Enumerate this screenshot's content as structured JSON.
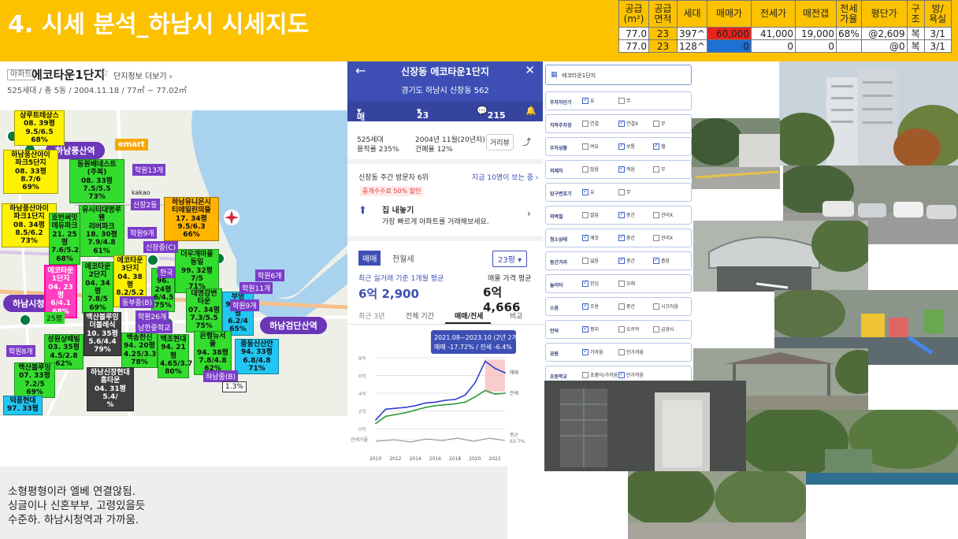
{
  "header": {
    "title": "4. 시세 분석_하남시 시세지도",
    "table": {
      "columns": [
        "공급\n(m²)",
        "공급\n면적",
        "세대",
        "매매가",
        "전세가",
        "매전갭",
        "전세\n가율",
        "평단가",
        "구\n조",
        "방/\n욕실"
      ],
      "rows": [
        [
          "77.0",
          "23",
          "397^",
          "60,000",
          "41,000",
          "19,000",
          "68%",
          "@2,609",
          "복",
          "3/1"
        ],
        [
          "77.0",
          "23",
          "128^",
          "0",
          "0",
          "0",
          "",
          "@0",
          "복",
          "3/1"
        ]
      ]
    }
  },
  "apt": {
    "tag": "아파트",
    "name": "에코타운1단지",
    "star": "☆",
    "more": "단지정보 더보기",
    "meta": "525세대 / 총 5동 / 2004.11.18 / 77㎡ ~ 77.02㎡"
  },
  "map": {
    "stations": [
      "하남풍산역",
      "하남시청역",
      "하남검단산역"
    ],
    "emart": "emart",
    "kakao": "kakao",
    "labels": [
      {
        "t": "상루트테상스\n08. 39평\n9.5/6.5\n68%",
        "c": "y"
      },
      {
        "t": "하남풍산아이\n파크5단지\n08. 33평\n8.7/6\n69%",
        "c": "y"
      },
      {
        "t": "동원베네스트\n(주복)\n08. 33평\n7.5/5.5\n73%",
        "c": "g"
      },
      {
        "t": "하남풍산아이\n파크1단지\n08. 34평\n8.5/6.2\n73%",
        "c": "y"
      },
      {
        "t": "유시티대명루웬\n리버파크\n18. 30평\n7.9/4.8\n61%",
        "c": "g"
      },
      {
        "t": "하남유니온시\n티에일린의뜰\n17. 34평\n9.5/6.3\n66%",
        "c": "o"
      },
      {
        "t": "호반써밋\n에듀파크\n21. 25평\n7.6/5.2\n68%",
        "c": "g"
      },
      {
        "t": "에코타운\n1단지\n04. 23평\n6/4.1\n68%",
        "c": "p"
      },
      {
        "t": "에코타운\n2단지\n04. 34평\n7.8/5\n69%",
        "c": "g"
      },
      {
        "t": "에코타운\n3단지\n04. 38평\n8.2/5.2\n63%",
        "c": "y"
      },
      {
        "t": "더우개마을\n동일\n99. 32평\n7/5\n71%",
        "c": "g"
      },
      {
        "t": "한국\n96. 24평\n6/4.5\n75%",
        "c": "g"
      },
      {
        "t": "대명강변\n타운\n07. 34평\n7.3/5.5\n75%",
        "c": "g"
      },
      {
        "t": "부영\n94. 25평\n6.2/4\n65%",
        "c": "c"
      },
      {
        "t": "성원상떼빌\n03. 35평\n4.5/2.8\n62%",
        "c": "g"
      },
      {
        "t": "백산블루밍\n더블레식\n10. 35평\n5.6/4.4\n79%",
        "c": "d"
      },
      {
        "t": "백송한신\n94. 20평\n4.25/3.3\n78%",
        "c": "g"
      },
      {
        "t": "백조현대\n94. 21평\n4.65/3.7\n80%",
        "c": "g"
      },
      {
        "t": "은행뉴서\n울\n94. 38평\n7.8/4.8\n62%",
        "c": "g"
      },
      {
        "t": "풍동신산안\n94. 33평\n6.8/4.8\n71%",
        "c": "c"
      },
      {
        "t": "백산블루밍\n07. 33평\n7.2/5\n69%",
        "c": "g"
      },
      {
        "t": "하남신장현대\n홈타운\n04. 31평\n5.4/\n%",
        "c": "d"
      },
      {
        "t": "덕풍현대\n97. 33평",
        "c": "c"
      }
    ],
    "tags": [
      "학원13개",
      "학원9개",
      "학원6개",
      "학원11개",
      "학원8개",
      "학원26개",
      "남한중학교",
      "동부중(B)",
      "신장2동",
      "학원9개",
      "하남중(B)",
      "한국",
      "1.3%",
      "25평"
    ],
    "misc_school": "신장중(C)"
  },
  "note": {
    "lines": [
      "소형평형이라 엘베 연결않됨.",
      "싱글이나 신혼부부, 고령있을듯",
      "수준하.   하남시청역과 가까움."
    ]
  },
  "phone": {
    "title": "신장동 에코타운1단지",
    "address": "경기도 하남시 신장동 562",
    "tab_deal": "매매",
    "tab_size": "23평",
    "tab_count": "215",
    "units": "525세대",
    "ratio": "용적률 235%",
    "built": "2004년 11월(20년차)",
    "bld_ratio": "건폐율 12%",
    "btn_street": "거리뷰",
    "visitors": "신장동 주간 방문자 6위",
    "live_view": "지금 10명이 보는 중",
    "fee": "중개수수료 50% 할인",
    "sell_title": "집 내놓기",
    "sell_sub": "가장 빠르게 아파트를 거래해보세요.",
    "deal_tab": "매매",
    "jeonse_tab": "전월세",
    "size_sel": "23평",
    "recent_label": "최근 실거래 기준 1개월 평균",
    "recent_value": "6억 2,900",
    "ask_label": "매물 가격 평균",
    "ask_value": "6억 4,666",
    "periods": [
      "최근 3년",
      "전체 기간",
      "매매/전세",
      "비교"
    ],
    "chart_tip1": "2021.08~2023.10 (2년 2개월)",
    "chart_tip2": "매매 -17.72%  /  전세 -6.4%",
    "chart_y": [
      "8억",
      "6억",
      "4억",
      "2억",
      "0억"
    ],
    "chart_x": [
      "2010",
      "2012",
      "2014",
      "2016",
      "2018",
      "2020",
      "2022"
    ],
    "chart_legend_deal": "매매",
    "chart_legend_jeonse": "전세",
    "chart_legend_jr": "전세가율",
    "chart_ratio_label": "평균",
    "chart_ratio_value": "63.7%"
  },
  "checklist": {
    "title": "에코타운1단지",
    "rows": [
      {
        "label": "주차차단기",
        "opts": [
          [
            "유",
            true
          ],
          [
            "무",
            false
          ]
        ]
      },
      {
        "label": "지하주차장",
        "opts": [
          [
            "연결",
            false
          ],
          [
            "연결X",
            true
          ],
          [
            "무",
            false
          ]
        ]
      },
      {
        "label": "주차상황",
        "opts": [
          [
            "여유",
            false
          ],
          [
            "보통",
            true
          ],
          [
            "헬",
            true
          ]
        ]
      },
      {
        "label": "외제차",
        "opts": [
          [
            "많음",
            false
          ],
          [
            "적음",
            true
          ],
          [
            "무",
            false
          ]
        ]
      },
      {
        "label": "입구변호기",
        "opts": [
          [
            "유",
            true
          ],
          [
            "무",
            false
          ]
        ]
      },
      {
        "label": "외벽칠",
        "opts": [
          [
            "깔끔",
            false
          ],
          [
            "중간",
            true
          ],
          [
            "관리X",
            false
          ]
        ]
      },
      {
        "label": "청소상태",
        "opts": [
          [
            "깨끗",
            true
          ],
          [
            "중간",
            true
          ],
          [
            "관리X",
            false
          ]
        ]
      },
      {
        "label": "동간거리",
        "opts": [
          [
            "넓음",
            false
          ],
          [
            "중간",
            true
          ],
          [
            "좁음",
            true
          ]
        ]
      },
      {
        "label": "놀이터",
        "opts": [
          [
            "한심",
            true
          ],
          [
            "모래",
            false
          ]
        ]
      },
      {
        "label": "소음",
        "opts": [
          [
            "조용",
            true
          ],
          [
            "중간",
            false
          ],
          [
            "시끄러움",
            false
          ]
        ]
      },
      {
        "label": "언덕",
        "opts": [
          [
            "평지",
            true
          ],
          [
            "오르막",
            false
          ],
          [
            "급경사",
            false
          ]
        ]
      },
      {
        "label": "공원",
        "opts": [
          [
            "가까움",
            true
          ],
          [
            "안가까움",
            false
          ]
        ]
      },
      {
        "label": "초등학교",
        "opts": [
          [
            "초품아/가까움",
            false
          ],
          [
            "안가까움",
            true
          ]
        ]
      }
    ]
  },
  "colors": {
    "header": "#fcc200",
    "phone_primary": "#3d4fb5",
    "deal_line": "#2f3fd6",
    "jeonse_line": "#2d9b3a",
    "drop_fill": "#f5b6b6"
  },
  "chart_data": {
    "type": "line",
    "x": [
      2010,
      2011,
      2012,
      2013,
      2014,
      2015,
      2016,
      2017,
      2018,
      2019,
      2020,
      2021,
      2022,
      2023
    ],
    "series": [
      {
        "name": "매매",
        "values": [
          1.0,
          2.2,
          2.3,
          2.4,
          2.6,
          2.9,
          3.0,
          3.2,
          3.3,
          3.8,
          5.2,
          7.6,
          6.8,
          6.3
        ]
      },
      {
        "name": "전세",
        "values": [
          0.6,
          1.4,
          1.6,
          1.8,
          2.1,
          2.4,
          2.6,
          2.7,
          2.8,
          3.0,
          3.6,
          4.3,
          3.9,
          4.0
        ]
      }
    ],
    "ylim": [
      0,
      8
    ]
  }
}
